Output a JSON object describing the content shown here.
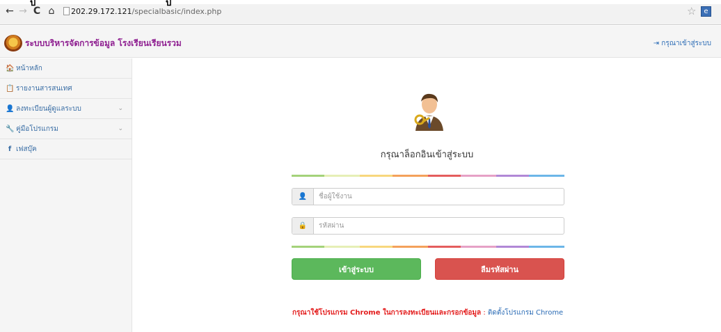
{
  "browser": {
    "tab_fragment_1": "ป",
    "tab_fragment_2": "ป",
    "url_host": "202.29.172.121",
    "url_path": "/specialbasic/index.php",
    "extension_label": "e"
  },
  "header": {
    "title": "ระบบบริหารจัดการข้อมูล โรงเรียนเรียนรวม",
    "login_link": "กรุณาเข้าสู่ระบบ"
  },
  "sidebar": {
    "items": [
      {
        "icon": "home-icon",
        "glyph": "🏠",
        "label": "หน้าหลัก",
        "has_chevron": false
      },
      {
        "icon": "report-icon",
        "glyph": "📋",
        "label": "รายงานสารสนเทศ",
        "has_chevron": false
      },
      {
        "icon": "user-icon",
        "glyph": "👤",
        "label": "ลงทะเบียนผู้ดูแลระบบ",
        "has_chevron": true
      },
      {
        "icon": "wrench-icon",
        "glyph": "🔧",
        "label": "คู่มือโปรแกรม",
        "has_chevron": true
      },
      {
        "icon": "facebook-icon",
        "glyph": "f",
        "label": "เฟสบุ๊ค",
        "has_chevron": false
      }
    ]
  },
  "login": {
    "heading": "กรุณาล็อกอินเข้าสู่ระบบ",
    "username_placeholder": "ชื่อผู้ใช้งาน",
    "password_placeholder": "รหัสผ่าน",
    "login_button": "เข้าสู่ระบบ",
    "forgot_button": "ลืมรหัสผ่าน",
    "notice_warning": "กรุณาใช้โปรแกรม Chrome ในการลงทะเบียนและกรอกข้อมูล",
    "notice_separator": " : ",
    "notice_link": "ติดตั้งโปรแกรม Chrome"
  },
  "colors": {
    "title": "#8e1e90",
    "link": "#2a6bb5",
    "login_button": "#5cb85c",
    "forgot_button": "#d9534f",
    "warning": "#e31b1b"
  }
}
